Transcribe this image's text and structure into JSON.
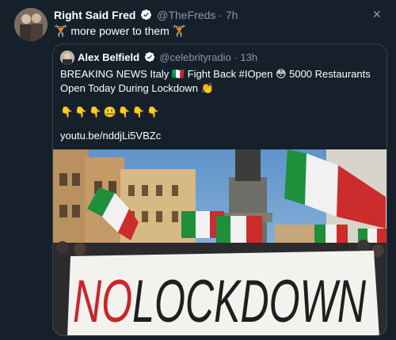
{
  "author": {
    "name": "Right Said Fred",
    "handle": "@TheFreds",
    "separator": "·",
    "time": "7h"
  },
  "tweet_text": "🏋 more power to them 🏋",
  "quoted": {
    "name": "Alex Belfield",
    "handle": "@celebrityradio",
    "separator": "·",
    "time": "13h",
    "text_line1": "BREAKING NEWS Italy 🇮🇹 Fight Back #IOpen 😳 5000 Restaurants",
    "text_line2": "Open Today During Lockdown 👏",
    "emoji_line": "👇👇👇🤐👇👇👇",
    "link": "youtu.be/nddjLi5VBZc",
    "image": {
      "banner_text": "NO LOCKDOWN"
    }
  },
  "icons": {
    "close": "close-icon",
    "verified": "verified-badge-icon"
  },
  "colors": {
    "background": "#15202b",
    "border": "#38444d",
    "muted": "#8899a6",
    "verified": "#ffffff"
  }
}
